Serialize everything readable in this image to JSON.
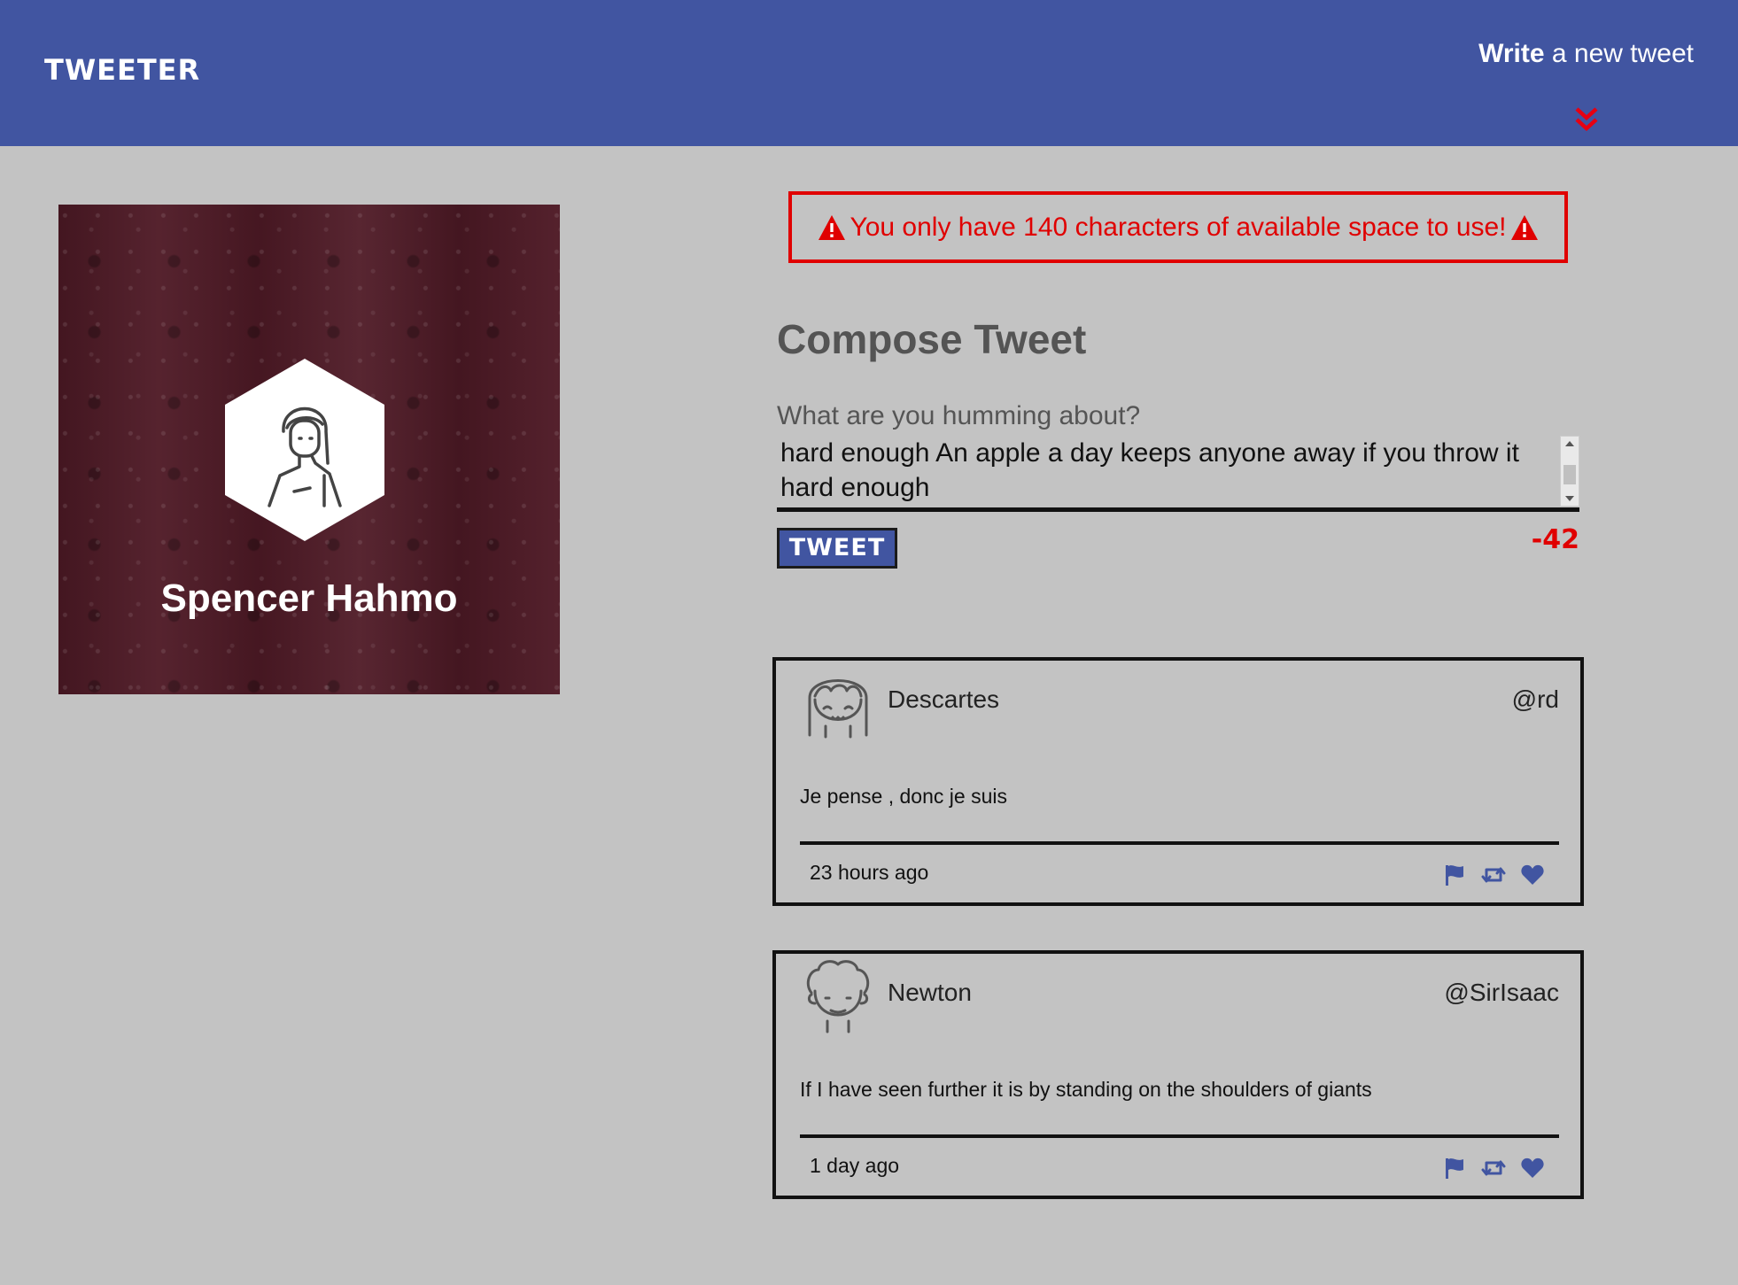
{
  "nav": {
    "brand": "TWEETER",
    "write_bold": "Write",
    "write_rest": " a new tweet"
  },
  "profile": {
    "name": "Spencer Hahmo"
  },
  "error": {
    "message": "You only have 140 characters of available space to use!"
  },
  "compose": {
    "title": "Compose Tweet",
    "label": "What are you humming about?",
    "text": "hard enough An apple a day keeps anyone away if you throw it hard enough",
    "button": "TWEET",
    "counter": "-42"
  },
  "tweets": [
    {
      "name": "Descartes",
      "handle": "@rd",
      "body": "Je pense , donc je suis",
      "time": "23 hours ago"
    },
    {
      "name": "Newton",
      "handle": "@SirIsaac",
      "body": "If I have seen further it is by standing on the shoulders of giants",
      "time": "1 day ago"
    }
  ],
  "colors": {
    "nav": "#4155a1",
    "background": "#c3c3c3",
    "error": "#e00000",
    "profile_bg": "#4f1a26"
  }
}
